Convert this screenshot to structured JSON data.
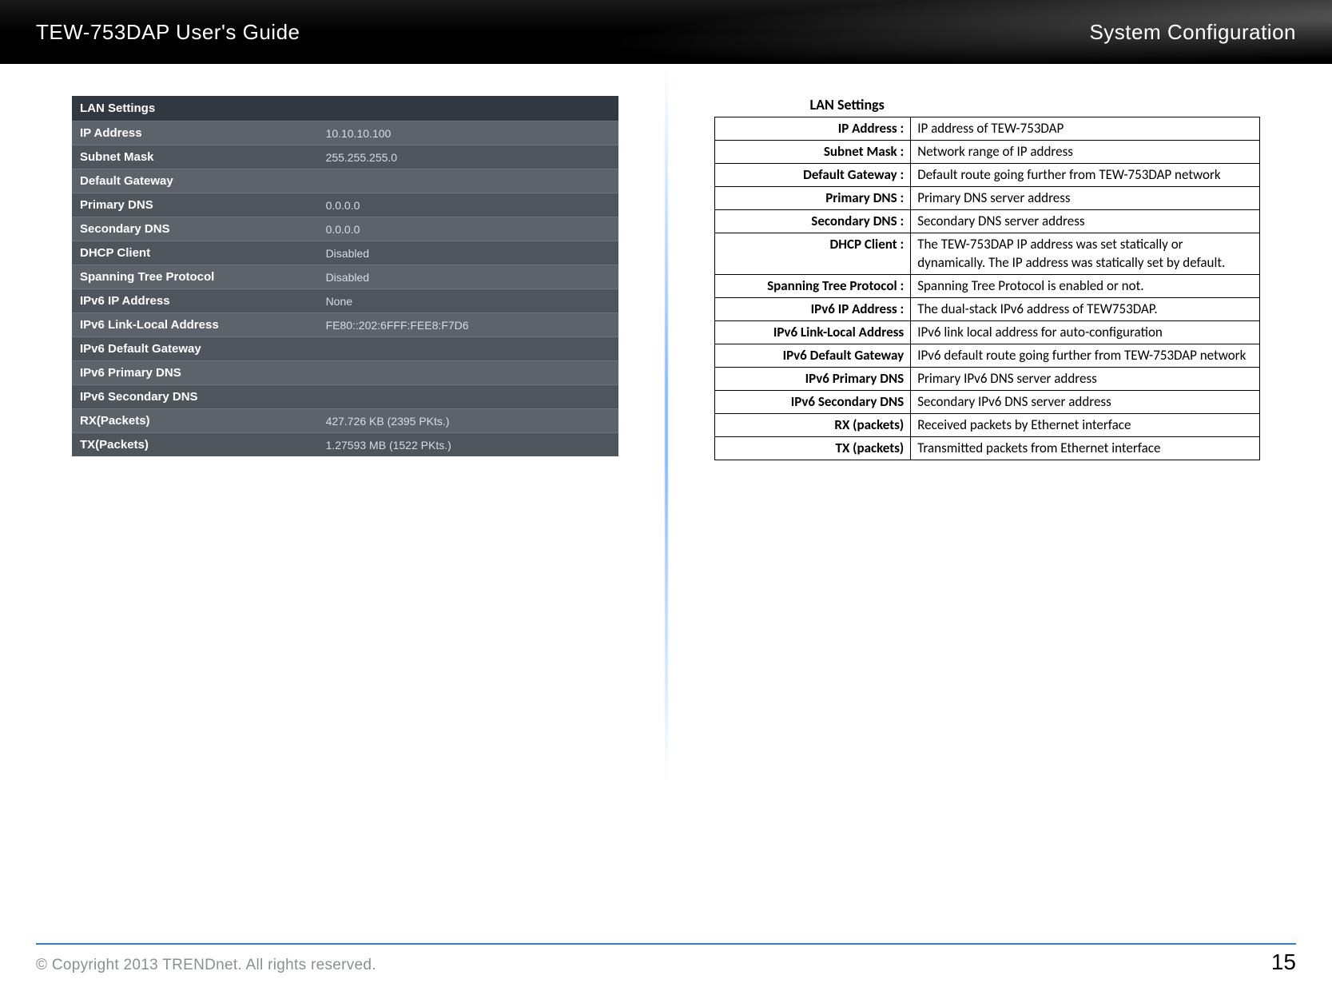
{
  "header": {
    "left": "TEW-753DAP User's Guide",
    "right": "System Configuration"
  },
  "lan_settings": {
    "title": "LAN Settings",
    "rows": [
      {
        "label": "IP Address",
        "value": "10.10.10.100"
      },
      {
        "label": "Subnet Mask",
        "value": "255.255.255.0"
      },
      {
        "label": "Default Gateway",
        "value": ""
      },
      {
        "label": "Primary DNS",
        "value": "0.0.0.0"
      },
      {
        "label": "Secondary DNS",
        "value": "0.0.0.0"
      },
      {
        "label": "DHCP Client",
        "value": "Disabled"
      },
      {
        "label": "Spanning Tree Protocol",
        "value": "Disabled"
      },
      {
        "label": "IPv6 IP Address",
        "value": "None"
      },
      {
        "label": "IPv6 Link-Local Address",
        "value": "FE80::202:6FFF:FEE8:F7D6"
      },
      {
        "label": "IPv6 Default Gateway",
        "value": ""
      },
      {
        "label": "IPv6 Primary DNS",
        "value": ""
      },
      {
        "label": "IPv6 Secondary DNS",
        "value": ""
      },
      {
        "label": "RX(Packets)",
        "value": "427.726 KB (2395 PKts.)"
      },
      {
        "label": "TX(Packets)",
        "value": "1.27593 MB (1522 PKts.)"
      }
    ]
  },
  "descriptions": {
    "title": "LAN Settings",
    "rows": [
      {
        "k": "IP Address :",
        "v": "IP address of TEW-753DAP"
      },
      {
        "k": "Subnet Mask :",
        "v": "Network range of IP address"
      },
      {
        "k": "Default Gateway :",
        "v": "Default route going further from TEW-753DAP network"
      },
      {
        "k": "Primary DNS :",
        "v": "Primary DNS server address"
      },
      {
        "k": "Secondary DNS :",
        "v": "Secondary DNS server address"
      },
      {
        "k": "DHCP Client :",
        "v": "The TEW-753DAP IP address was set statically or dynamically. The IP address was statically set by default."
      },
      {
        "k": "Spanning Tree Protocol :",
        "v": "Spanning Tree Protocol is enabled or not."
      },
      {
        "k": "IPv6 IP Address :",
        "v": "The dual-stack IPv6 address of TEW753DAP."
      },
      {
        "k": "IPv6 Link-Local Address",
        "v": "IPv6 link local address for auto-configuration"
      },
      {
        "k": "IPv6 Default Gateway",
        "v": "IPv6 default route going further from TEW-753DAP network"
      },
      {
        "k": "IPv6 Primary DNS",
        "v": "Primary IPv6 DNS server address"
      },
      {
        "k": "IPv6 Secondary DNS",
        "v": "Secondary IPv6 DNS server address"
      },
      {
        "k": "RX (packets)",
        "v": "Received packets by Ethernet interface"
      },
      {
        "k": "TX (packets)",
        "v": "Transmitted packets from Ethernet interface"
      }
    ]
  },
  "footer": {
    "copyright": "© Copyright 2013 TRENDnet. All rights reserved.",
    "page": "15"
  }
}
